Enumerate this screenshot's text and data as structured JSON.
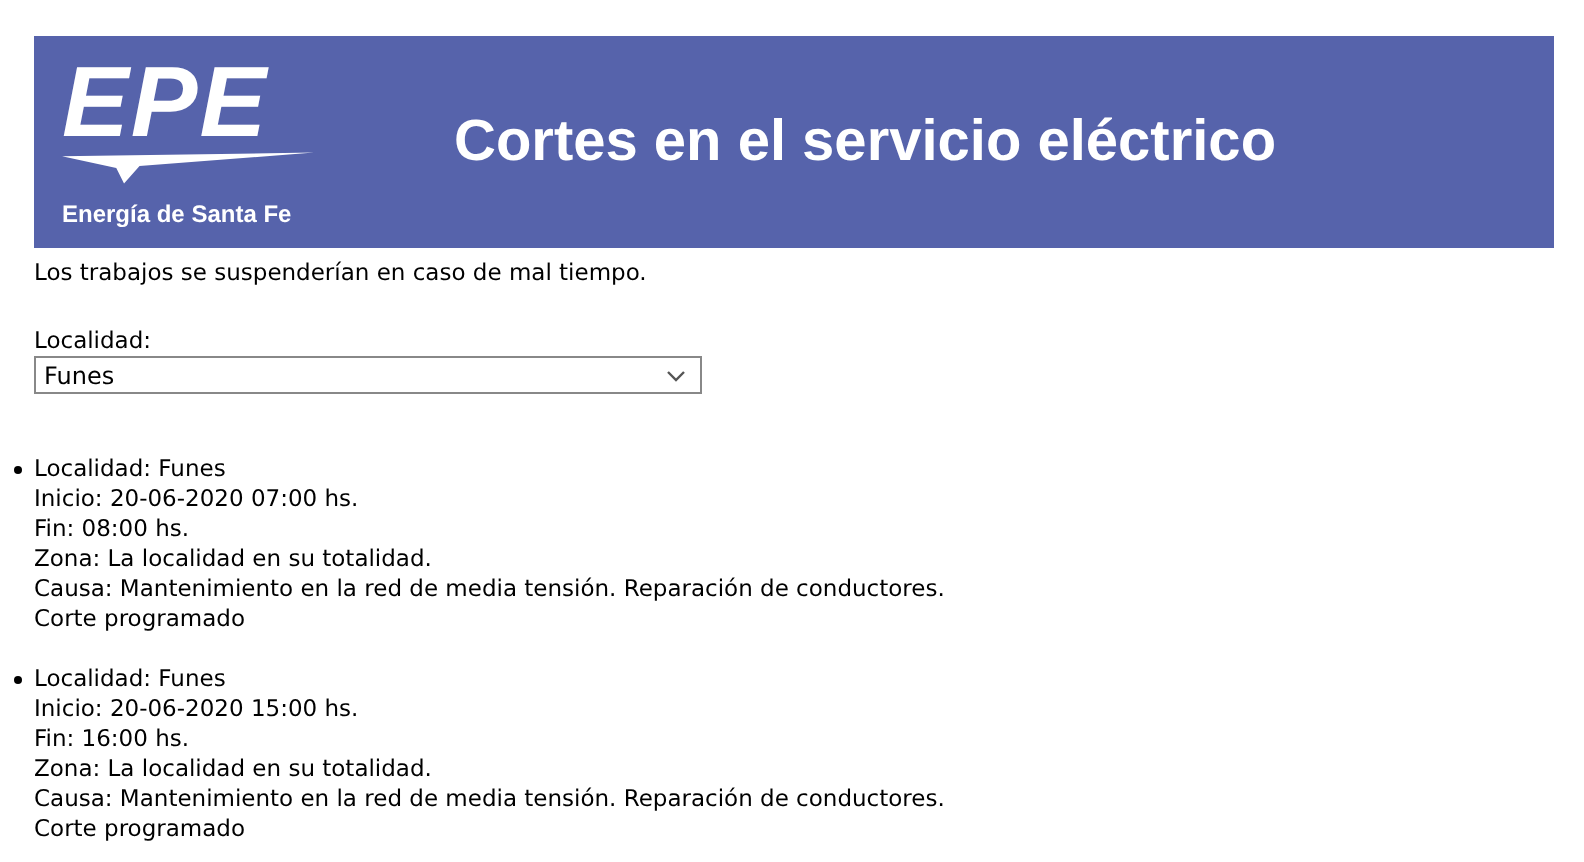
{
  "banner": {
    "logo_text": "EPE",
    "logo_caption": "Energía de Santa Fe",
    "title": "Cortes en el servicio eléctrico"
  },
  "notice": "Los trabajos se suspenderían en caso de mal tiempo.",
  "locality_field": {
    "label": "Localidad:",
    "value": "Funes"
  },
  "outages": [
    {
      "lines": [
        "Localidad: Funes",
        "Inicio: 20-06-2020 07:00 hs.",
        "Fin: 08:00 hs.",
        "Zona: La localidad en su totalidad.",
        "Causa: Mantenimiento en la red de media tensión. Reparación de conductores.",
        "Corte programado"
      ]
    },
    {
      "lines": [
        "Localidad: Funes",
        "Inicio: 20-06-2020 15:00 hs.",
        "Fin: 16:00 hs.",
        "Zona: La localidad en su totalidad.",
        "Causa: Mantenimiento en la red de media tensión. Reparación de conductores.",
        "Corte programado"
      ]
    }
  ]
}
